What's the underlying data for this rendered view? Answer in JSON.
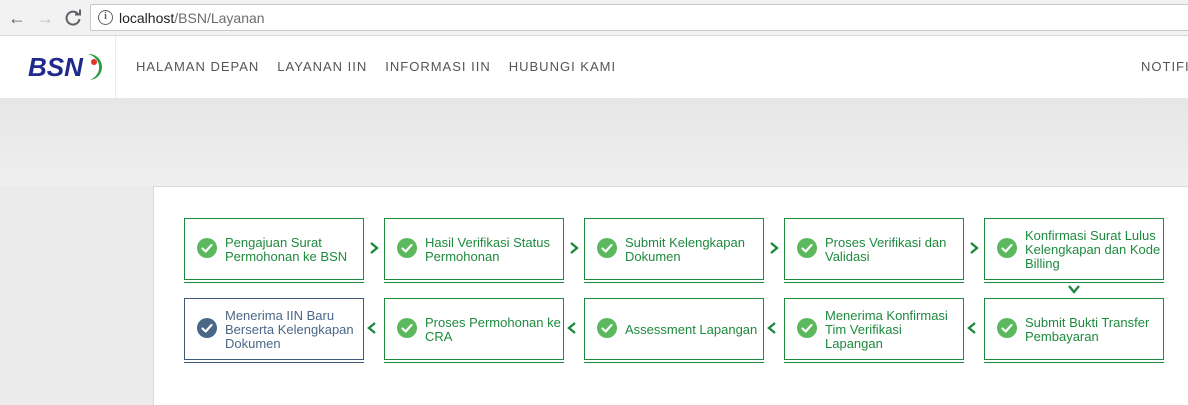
{
  "browser": {
    "url_host": "localhost",
    "url_path": "/BSN/Layanan"
  },
  "colors": {
    "done_green": "#1e8a3e",
    "check_green": "#5cb85c",
    "current_blue": "#4a6788"
  },
  "header": {
    "logo_text": "BSN",
    "menu": [
      "HALAMAN DEPAN",
      "LAYANAN IIN",
      "INFORMASI IIN",
      "HUBUNGI KAMI"
    ],
    "notif_label": "NOTIFI"
  },
  "steps": {
    "row1": [
      {
        "label": "Pengajuan Surat Permohonan ke BSN",
        "status": "done",
        "icon": "check-circle-icon"
      },
      {
        "label": "Hasil Verifikasi Status Permohonan",
        "status": "done",
        "icon": "check-circle-icon"
      },
      {
        "label": "Submit Kelengkapan Dokumen",
        "status": "done",
        "icon": "check-circle-icon"
      },
      {
        "label": "Proses Verifikasi dan Validasi",
        "status": "done",
        "icon": "check-circle-icon"
      },
      {
        "label": "Konfirmasi Surat Lulus Kelengkapan dan Kode Billing",
        "status": "done",
        "icon": "check-circle-icon"
      }
    ],
    "row2": [
      {
        "label": "Menerima IIN Baru Berserta Kelengkapan Dokumen",
        "status": "current",
        "icon": "check-circle-icon"
      },
      {
        "label": "Proses Permohonan ke CRA",
        "status": "done",
        "icon": "check-circle-icon"
      },
      {
        "label": "Assessment Lapangan",
        "status": "done",
        "icon": "check-circle-icon"
      },
      {
        "label": "Menerima Konfirmasi Tim Verifikasi Lapangan",
        "status": "done",
        "icon": "check-circle-icon"
      },
      {
        "label": "Submit Bukti Transfer Pembayaran",
        "status": "done",
        "icon": "check-circle-icon"
      }
    ]
  }
}
